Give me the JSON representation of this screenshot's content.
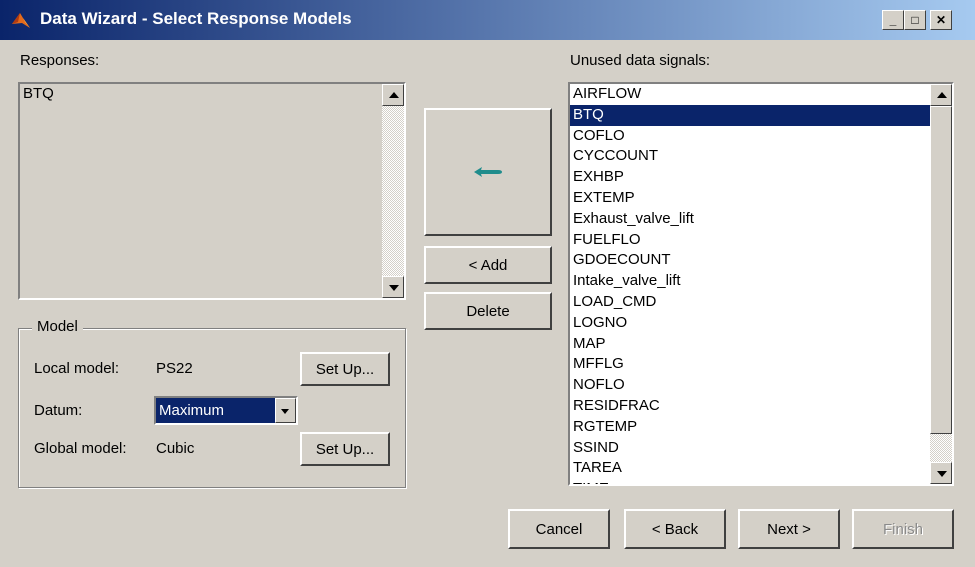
{
  "window": {
    "title": "Data Wizard - Select Response Models",
    "controls": {
      "minimize": "_",
      "maximize": "□",
      "close": "✕"
    }
  },
  "responses": {
    "label": "Responses:",
    "items": [
      "BTQ"
    ]
  },
  "unused": {
    "label": "Unused data signals:",
    "items": [
      "AIRFLOW",
      "BTQ",
      "COFLO",
      "CYCCOUNT",
      "EXHBP",
      "EXTEMP",
      "Exhaust_valve_lift",
      "FUELFLO",
      "GDOECOUNT",
      "Intake_valve_lift",
      "LOAD_CMD",
      "LOGNO",
      "MAP",
      "MFFLG",
      "NOFLO",
      "RESIDFRAC",
      "RGTEMP",
      "SSIND",
      "TAREA",
      "TIME"
    ],
    "selected": "BTQ"
  },
  "actions": {
    "add": "< Add",
    "delete": "Delete"
  },
  "model": {
    "group_title": "Model",
    "local_label": "Local model:",
    "local_value": "PS22",
    "datum_label": "Datum:",
    "datum_value": "Maximum",
    "global_label": "Global model:",
    "global_value": "Cubic",
    "setup_label": "Set Up..."
  },
  "footer": {
    "cancel": "Cancel",
    "back": "< Back",
    "next": "Next >",
    "finish": "Finish"
  },
  "colors": {
    "selection": "#0a246a",
    "arrow": "#1f8c8c",
    "face": "#d4d0c8"
  }
}
